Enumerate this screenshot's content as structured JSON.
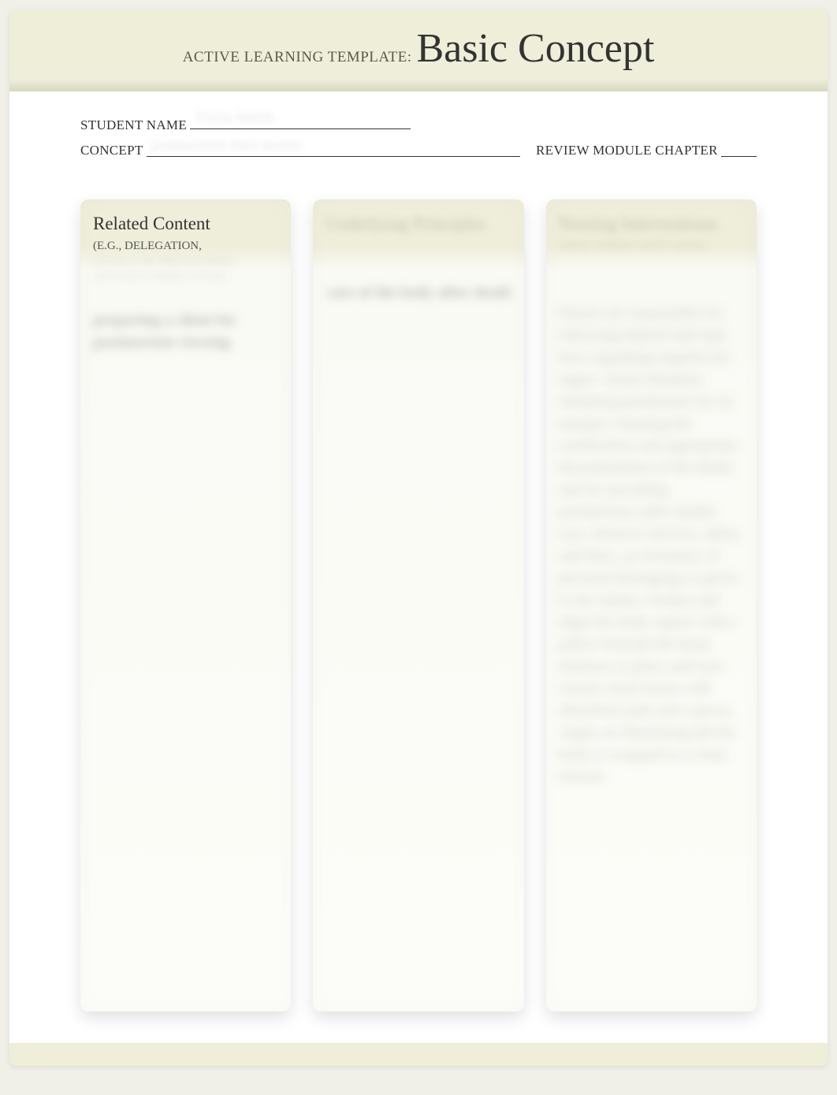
{
  "header": {
    "prefix": "ACTIVE LEARNING TEMPLATE:",
    "title": "Basic Concept"
  },
  "info": {
    "student_label": "STUDENT NAME",
    "student_value": "Tricia Smith",
    "concept_label": "CONCEPT",
    "concept_value": "postmortem then mortis",
    "chapter_label": "REVIEW MODULE CHAPTER",
    "chapter_value": ""
  },
  "columns": {
    "related": {
      "title": "Related Content",
      "subtitle1": "(E.G., DELEGATION,",
      "subtitle2": "LEVELS OF PREVENTION,",
      "subtitle3": "ADVANCE DIRECTIVES)",
      "body": "preparing a client for postmortem viewing"
    },
    "principles": {
      "title": "Underlying Principles",
      "body": "care of the body after death"
    },
    "nursing": {
      "title": "Nursing Interventions",
      "subtitle": "WHO? WHEN? WHY? HOW?",
      "body": "Nurses are responsible for following federal and state laws regarding requests for organ / tissue donation, obtaining permission for an autopsy, ensuring the certification and appropriate documentation of the death, and for providing postmortem (after death) care. Remove devices, tubes, and lines, an inventory of personal belongings is given to the family, freshen and align the body supine with a pillow beneath the head, dentures in place and eyes closed, fresh linens with absorbent pads and a gown, Apply an identifying tab the body is wrapped in a clean shroud."
    }
  }
}
